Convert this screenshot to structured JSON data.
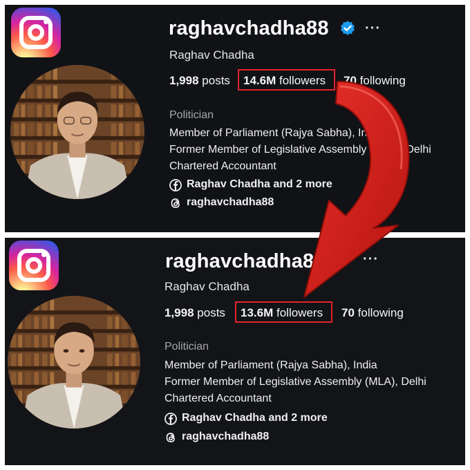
{
  "profile_top": {
    "username": "raghavchadha88",
    "more_label": "···",
    "full_name": "Raghav Chadha",
    "posts_count": "1,998",
    "posts_label": "posts",
    "followers_count": "14.6M",
    "followers_label": "followers",
    "following_count": "70",
    "following_label": "following",
    "category": "Politician",
    "bio": [
      "Member of Parliament (Rajya Sabha), India",
      "Former Member of Legislative Assembly (MLA), Delhi",
      "Chartered Accountant"
    ],
    "facebook_link": "Raghav Chadha and 2 more",
    "threads_link": "raghavchadha88",
    "verified": true
  },
  "profile_bottom": {
    "username": "raghavchadha88",
    "more_label": "···",
    "full_name": "Raghav Chadha",
    "posts_count": "1,998",
    "posts_label": "posts",
    "followers_count": "13.6M",
    "followers_label": "followers",
    "following_count": "70",
    "following_label": "following",
    "category": "Politician",
    "bio": [
      "Member of Parliament (Rajya Sabha), India",
      "Former Member of Legislative Assembly (MLA), Delhi",
      "Chartered Accountant"
    ],
    "facebook_link": "Raghav Chadha and 2 more",
    "threads_link": "raghavchadha88"
  },
  "colors": {
    "highlight": "#e3232b",
    "arrow": "#d9231c",
    "verified": "#1d9bf0",
    "background": "#101216"
  },
  "icons": [
    "instagram-logo-icon",
    "verified-badge-icon",
    "facebook-icon",
    "threads-icon",
    "curved-arrow-icon"
  ]
}
